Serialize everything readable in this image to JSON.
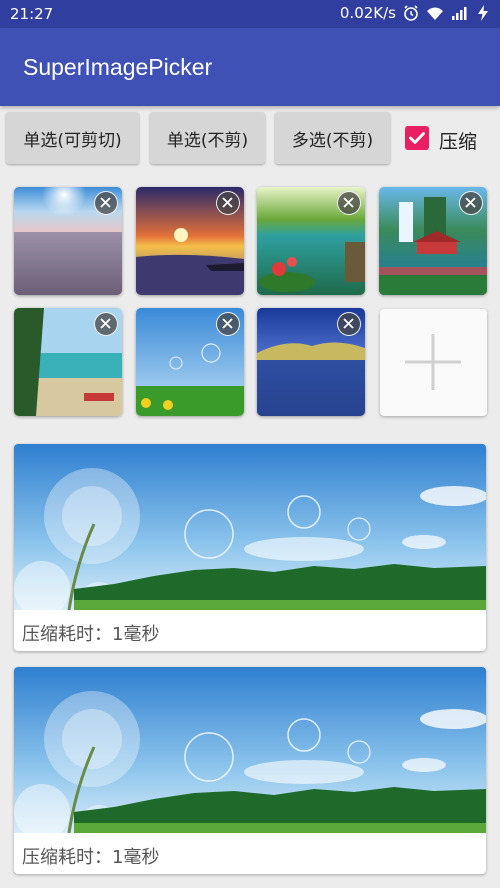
{
  "status_bar": {
    "time": "21:27",
    "net_speed": "0.02K/s",
    "icons": [
      "alarm-icon",
      "wifi-icon",
      "signal-icon",
      "charging-icon"
    ]
  },
  "app_bar": {
    "title": "SuperImagePicker"
  },
  "toolbar": {
    "single_crop_label": "单选(可剪切)",
    "single_nocrop_label": "单选(不剪)",
    "multi_label": "多选(不剪)",
    "compress_label": "压缩",
    "compress_checked": true
  },
  "colors": {
    "status_bar": "#303f9f",
    "app_bar": "#3f51b5",
    "checkbox": "#e91e63",
    "background": "#ececec"
  },
  "thumbnails": [
    {
      "subject": "sun over sea"
    },
    {
      "subject": "sunset lake"
    },
    {
      "subject": "lotus lake"
    },
    {
      "subject": "waterfall pavilion"
    },
    {
      "subject": "tropical beach"
    },
    {
      "subject": "dandelion sky"
    },
    {
      "subject": "mountain lake"
    }
  ],
  "add_button_icon": "plus-icon",
  "results": [
    {
      "caption": "压缩耗时：1毫秒"
    },
    {
      "caption": "压缩耗时：1毫秒"
    }
  ]
}
